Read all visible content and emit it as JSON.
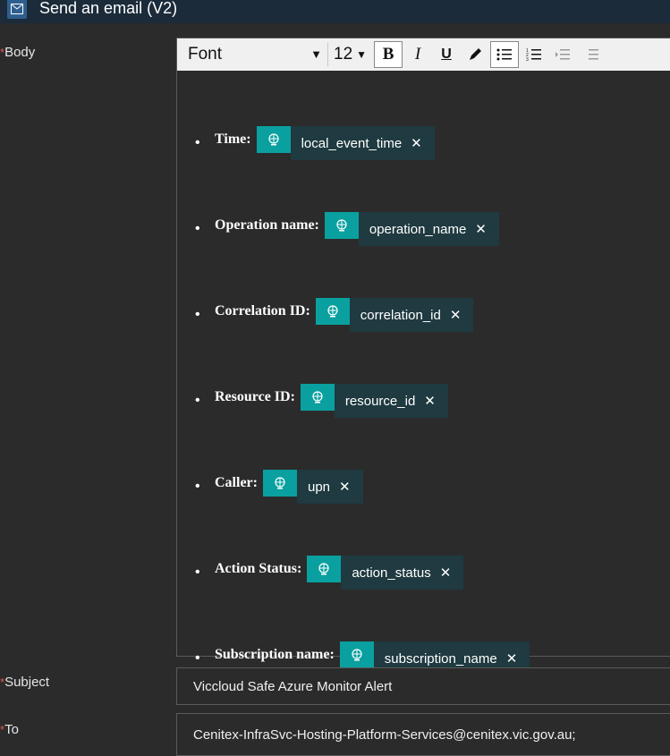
{
  "header": {
    "title": "Send an email (V2)",
    "icon": "mail-icon"
  },
  "fields": {
    "body_label": "Body",
    "subject_label": "Subject",
    "to_label": "To",
    "required_marker": "*"
  },
  "toolbar": {
    "font": "Font",
    "size": "12",
    "bold": "B",
    "italic": "I",
    "underline": "U"
  },
  "body_items": [
    {
      "label": "Time:",
      "token": "local_event_time"
    },
    {
      "label": "Operation name:",
      "token": "operation_name"
    },
    {
      "label": "Correlation ID:",
      "token": "correlation_id"
    },
    {
      "label": "Resource ID:",
      "token": "resource_id"
    },
    {
      "label": "Caller:",
      "token": "upn"
    },
    {
      "label": "Action Status:",
      "token": "action_status"
    },
    {
      "label": "Subscription name:",
      "token": "subscription_name"
    }
  ],
  "subject_value": "Viccloud Safe Azure Monitor Alert",
  "to_value": "Cenitex-InfraSvc-Hosting-Platform-Services@cenitex.vic.gov.au;",
  "colors": {
    "token_icon": "#0aa0a0",
    "token_bg": "#1f3a40",
    "header_bg": "#1b2b3a",
    "required": "#e05555"
  }
}
